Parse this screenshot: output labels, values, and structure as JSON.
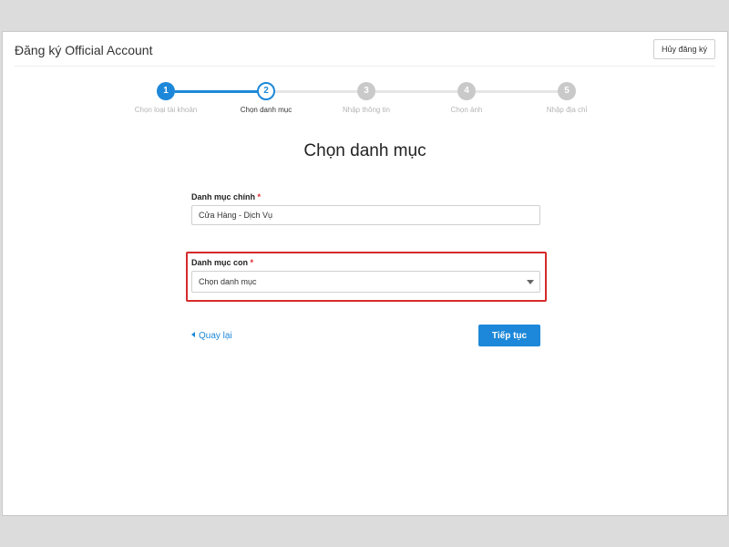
{
  "header": {
    "title": "Đăng ký Official Account",
    "cancel_label": "Hủy đăng ký"
  },
  "stepper": {
    "steps": [
      {
        "number": "1",
        "label": "Chọn loại tài khoản",
        "state": "done"
      },
      {
        "number": "2",
        "label": "Chọn danh mục",
        "state": "current"
      },
      {
        "number": "3",
        "label": "Nhập thông tin",
        "state": "todo"
      },
      {
        "number": "4",
        "label": "Chọn ảnh",
        "state": "todo"
      },
      {
        "number": "5",
        "label": "Nhập địa chỉ",
        "state": "todo"
      }
    ]
  },
  "main": {
    "title": "Chọn danh mục",
    "main_category": {
      "label": "Danh mục chính",
      "required_mark": "*",
      "value": "Cửa Hàng - Dịch Vụ"
    },
    "sub_category": {
      "label": "Danh mục con",
      "required_mark": "*",
      "selected": "Chọn danh mục"
    },
    "back_label": "Quay lại",
    "next_label": "Tiếp tục"
  },
  "colors": {
    "accent": "#1d88d9",
    "highlight": "#d52b2b",
    "required": "#e0262c"
  }
}
